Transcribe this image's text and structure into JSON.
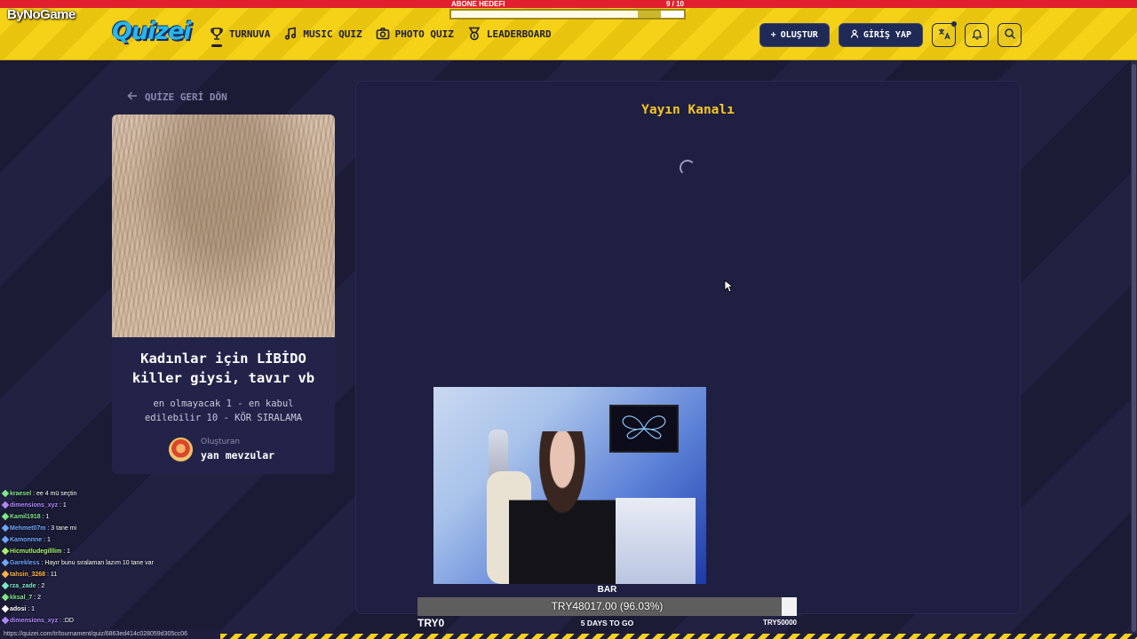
{
  "stream_overlay": {
    "brand": "ByNoGame",
    "goal_label": "ABONE HEDEFI",
    "goal_progress_text": "9 / 10",
    "goal_fraction": 0.9
  },
  "site": {
    "logo": "Quizei",
    "nav": [
      {
        "label": "TURNUVA",
        "icon": "trophy-icon",
        "active": true
      },
      {
        "label": "MUSIC QUIZ",
        "icon": "music-note-icon"
      },
      {
        "label": "PHOTO QUIZ",
        "icon": "camera-icon"
      },
      {
        "label": "LEADERBOARD",
        "icon": "medal-icon"
      }
    ],
    "create_label": "OLUŞTUR",
    "login_label": "GİRİŞ YAP"
  },
  "left": {
    "back_label": "QUİZE GERİ DÖN",
    "quiz_title": "Kadınlar için LİBİDO killer giysi, tavır vb",
    "quiz_subtitle": "en olmayacak 1 - en kabul edilebilir 10 - KÖR SIRALAMA",
    "creator_label": "Oluşturan",
    "creator_name": "yan mevzular"
  },
  "main": {
    "title": "Yayın Kanalı"
  },
  "donation": {
    "label": "BAR",
    "amount_text": "TRY48017.00 (96.03%)",
    "fraction": 0.9603,
    "left_label": "TRY0",
    "center_label": "5 DAYS TO GO",
    "right_label": "TRY50000"
  },
  "chat": [
    {
      "user": "kraesel",
      "msg": "ee 4 mü seçtin",
      "color": "#7ee787"
    },
    {
      "user": "dimensions_xyz",
      "msg": "1",
      "color": "#b388ff"
    },
    {
      "user": "Kamil1918",
      "msg": "1",
      "color": "#7ee787"
    },
    {
      "user": "Mehmet07m",
      "msg": "3 tane mi",
      "color": "#6ea8fe"
    },
    {
      "user": "Kamonnne",
      "msg": "1",
      "color": "#6ea8fe"
    },
    {
      "user": "Hicmutludegilllim",
      "msg": "1",
      "color": "#a5f36b"
    },
    {
      "user": "Garekless",
      "msg": "Hayır bunu sıralaman lazım 10 tane var",
      "color": "#6ea8fe"
    },
    {
      "user": "tahsin_3268",
      "msg": "11",
      "color": "#ffb347"
    },
    {
      "user": "rza_zade",
      "msg": "2",
      "color": "#7ee7c7"
    },
    {
      "user": "kksal_7",
      "msg": "2",
      "color": "#7ee787"
    },
    {
      "user": "adosi",
      "msg": "1",
      "color": "#ffffff"
    },
    {
      "user": "dimensions_xyz",
      "msg": ":DD",
      "color": "#b388ff"
    }
  ],
  "status_url": "https://quizei.com/tr/tournament/quiz/6863ed414c028059d305cc06",
  "colors": {
    "header_yellow": "#f5d118",
    "accent_red": "#e0202e",
    "title_yellow": "#f3c623",
    "panel_bg": "#1f1f42",
    "button_navy": "#1f2a56"
  }
}
